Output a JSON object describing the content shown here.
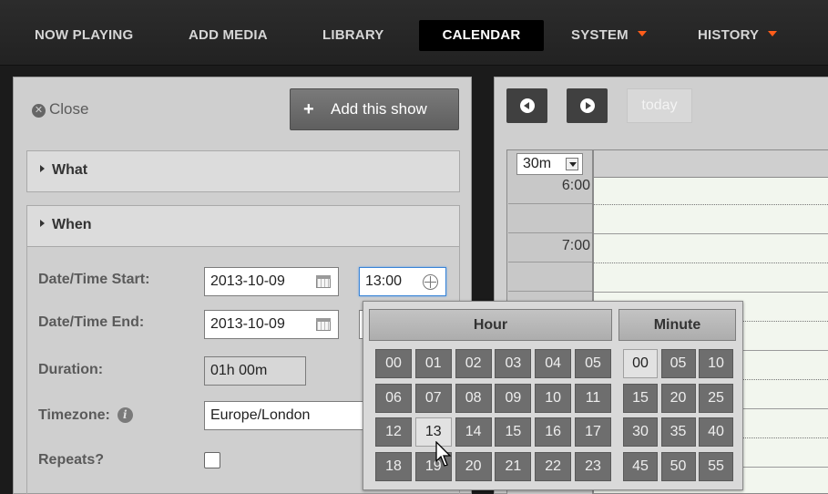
{
  "nav": {
    "items": [
      {
        "label": "NOW PLAYING"
      },
      {
        "label": "ADD MEDIA"
      },
      {
        "label": "LIBRARY"
      },
      {
        "label": "CALENDAR",
        "active": true
      },
      {
        "label": "SYSTEM",
        "dropdown": true
      },
      {
        "label": "HISTORY",
        "dropdown": true
      }
    ]
  },
  "form": {
    "close_label": "Close",
    "add_show_label": "Add this show",
    "sections": {
      "what": "What",
      "when": "When"
    },
    "fields": {
      "start_label": "Date/Time Start:",
      "start_date": "2013-10-09",
      "start_time": "13:00",
      "end_label": "Date/Time End:",
      "end_date": "2013-10-09",
      "duration_label": "Duration:",
      "duration_value": "01h 00m",
      "timezone_label": "Timezone:",
      "timezone_value": "Europe/London",
      "repeats_label": "Repeats?",
      "repeats_checked": false
    }
  },
  "calendar": {
    "today_label": "today",
    "slot_size": "30m",
    "times": [
      "6:00",
      "7:00"
    ],
    "colors": {
      "background": "#f2f6ee"
    }
  },
  "timepicker": {
    "hour_header": "Hour",
    "minute_header": "Minute",
    "hours": [
      "00",
      "01",
      "02",
      "03",
      "04",
      "05",
      "06",
      "07",
      "08",
      "09",
      "10",
      "11",
      "12",
      "13",
      "14",
      "15",
      "16",
      "17",
      "18",
      "19",
      "20",
      "21",
      "22",
      "23"
    ],
    "minutes": [
      "00",
      "05",
      "10",
      "15",
      "20",
      "25",
      "30",
      "35",
      "40",
      "45",
      "50",
      "55"
    ],
    "selected_hour": "13",
    "selected_minute": "00"
  },
  "icons": {
    "close": "close-circle-icon",
    "plus": "plus-icon",
    "calendar": "calendar-icon",
    "clock": "clock-icon",
    "info": "info-icon",
    "prev": "prev-arrow-icon",
    "next": "next-arrow-icon"
  }
}
